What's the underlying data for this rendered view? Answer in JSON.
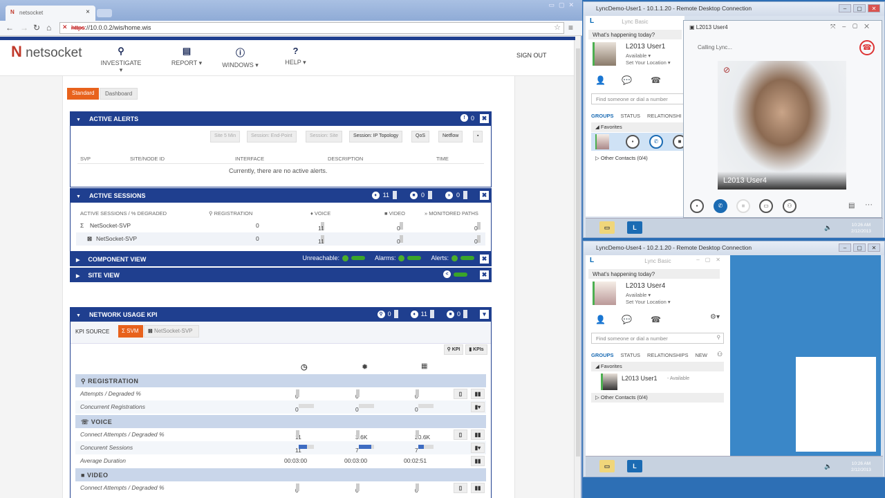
{
  "browser": {
    "tab_title": "netsocket",
    "url_scheme": "https",
    "url_rest": "://10.0.0.2/wis/home.wis"
  },
  "header": {
    "brand": "netsocket",
    "menu": [
      {
        "label": "INVESTIGATE",
        "icon": "search-icon"
      },
      {
        "label": "REPORT",
        "icon": "report-icon"
      },
      {
        "label": "WINDOWS",
        "icon": "info-icon"
      },
      {
        "label": "HELP",
        "icon": "help-icon"
      }
    ],
    "sign_out": "SIGN OUT"
  },
  "view_toggle": {
    "standard": "Standard",
    "dashboard": "Dashboard",
    "active": "Standard"
  },
  "active_alerts": {
    "title": "ACTIVE ALERTS",
    "alert_count": "0",
    "toolbar": [
      "Site 5 Min",
      "Session: End-Point",
      "Session: Site",
      "Session: IP Topology",
      "QoS",
      "Netflow"
    ],
    "columns": [
      "SVP",
      "SITE/NODE ID",
      "INTERFACE",
      "DESCRIPTION",
      "TIME"
    ],
    "empty_message": "Currently, there are no active alerts."
  },
  "active_sessions": {
    "title": "ACTIVE SESSIONS",
    "voice_count": "11",
    "video_count": "0",
    "paths_count": "0",
    "columns": [
      "ACTIVE SESSIONS / % DEGRADED",
      "REGISTRATION",
      "VOICE",
      "VIDEO",
      "MONITORED PATHS"
    ],
    "rows": [
      {
        "name": "NetSocket-SVP",
        "registration": "0",
        "voice": "11",
        "video": "0",
        "paths": "0"
      },
      {
        "name": "NetSocket-SVP",
        "registration": "0",
        "voice": "11",
        "video": "0",
        "paths": "0"
      }
    ]
  },
  "component_view": {
    "title": "COMPONENT VIEW",
    "unreachable": "Unreachable:",
    "alarms": "Alarms:",
    "alerts": "Alerts:",
    "status_color": "#4caf2a"
  },
  "site_view": {
    "title": "SITE VIEW"
  },
  "network_kpi": {
    "title": "NETWORK USAGE KPI",
    "registration_count": "0",
    "voice_count": "11",
    "video_count": "0",
    "kpi_source_label": "KPI SOURCE",
    "sources": [
      "SVM",
      "NetSocket-SVP"
    ],
    "active_source": "SVM",
    "buttons": [
      "KPI",
      "KPIs"
    ],
    "sections": [
      {
        "title": "REGISTRATION",
        "rows": [
          {
            "label": "Attempts / Degraded %",
            "values": [
              "0",
              "0",
              "0"
            ]
          },
          {
            "label": "Concurrent Registrations",
            "values": [
              "0",
              "0",
              "0"
            ]
          }
        ]
      },
      {
        "title": "VOICE",
        "rows": [
          {
            "label": "Connect Attempts / Degraded %",
            "values": [
              "11",
              "3.6K",
              "20.6K"
            ]
          },
          {
            "label": "Concurent Sessions",
            "values": [
              "11",
              "7",
              "7"
            ],
            "fill": [
              0.55,
              0.8,
              0.35
            ]
          },
          {
            "label": "Average Duration",
            "values": [
              "00:03:00",
              "00:03:00",
              "00:02:51"
            ]
          }
        ]
      },
      {
        "title": "VIDEO",
        "rows": [
          {
            "label": "Connect Attempts / Degraded %",
            "values": [
              "0",
              "0",
              "0"
            ]
          }
        ]
      }
    ]
  },
  "rdp1": {
    "title": "LyncDemo-User1 - 10.1.1.20 - Remote Desktop Connection",
    "lync_title": "Lync Basic",
    "whats_happening": "What's happening today?",
    "user": "L2013 User1",
    "status": "Available",
    "location": "Set Your Location",
    "search_placeholder": "Find someone or dial a number",
    "tabs": [
      "GROUPS",
      "STATUS",
      "RELATIONSHI"
    ],
    "favorites": "Favorites",
    "other_contacts": "Other Contacts (0/4)",
    "conversation": {
      "title": "L2013 User4",
      "status": "Calling Lync...",
      "caller": "L2013 User4"
    },
    "clock_time": "10:26 AM",
    "clock_date": "2/12/2013"
  },
  "rdp2": {
    "title": "LyncDemo-User4 - 10.2.1.20 - Remote Desktop Connection",
    "lync_title": "Lync Basic",
    "whats_happening": "What's happening today?",
    "user": "L2013 User4",
    "status": "Available",
    "location": "Set Your Location",
    "search_placeholder": "Find someone or dial a number",
    "tabs": [
      "GROUPS",
      "STATUS",
      "RELATIONSHIPS",
      "NEW"
    ],
    "favorites": "Favorites",
    "contact_name": "L2013 User1",
    "contact_status": "- Available",
    "other_contacts": "Other Contacts (0/4)",
    "clock_time": "10:26 AM",
    "clock_date": "2/12/2013"
  }
}
